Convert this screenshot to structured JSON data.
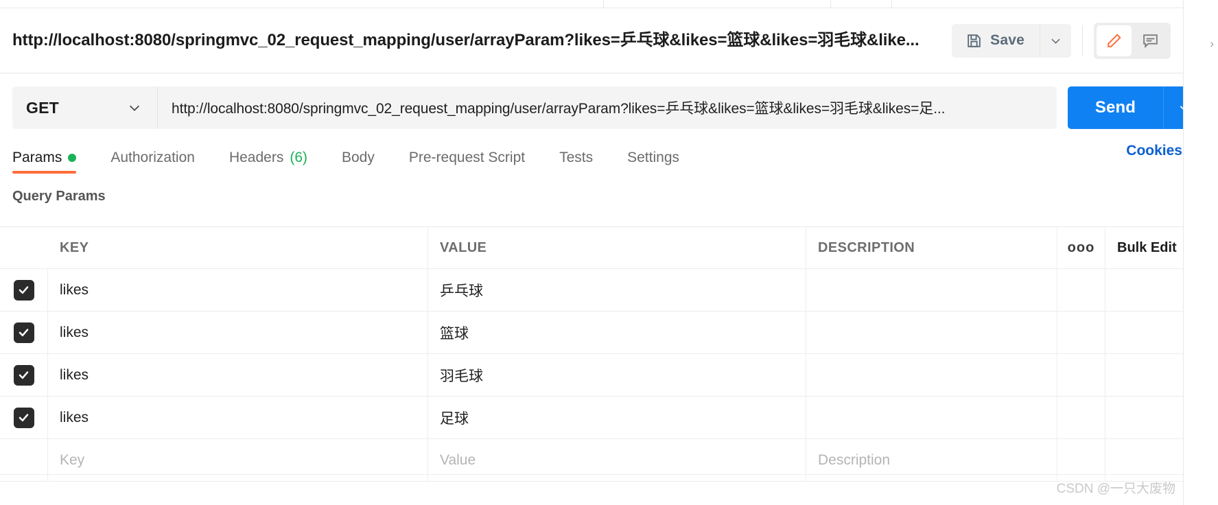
{
  "app": "Postman",
  "header": {
    "request_title": "http://localhost:8080/springmvc_02_request_mapping/user/arrayParam?likes=乒乓球&likes=篮球&likes=羽毛球&like...",
    "save_label": "Save",
    "save_icon": "floppy-disk-icon",
    "save_caret_icon": "chevron-down-icon",
    "edit_icon": "pencil-icon",
    "comment_icon": "comment-icon"
  },
  "url_bar": {
    "method": "GET",
    "method_caret_icon": "chevron-down-icon",
    "url": "http://localhost:8080/springmvc_02_request_mapping/user/arrayParam?likes=乒乓球&likes=篮球&likes=羽毛球&likes=足...",
    "send_label": "Send",
    "send_caret_icon": "chevron-down-icon"
  },
  "tabs": [
    {
      "label": "Params",
      "active": true,
      "dot": true
    },
    {
      "label": "Authorization",
      "active": false
    },
    {
      "label": "Headers",
      "active": false,
      "count": "(6)"
    },
    {
      "label": "Body",
      "active": false
    },
    {
      "label": "Pre-request Script",
      "active": false
    },
    {
      "label": "Tests",
      "active": false
    },
    {
      "label": "Settings",
      "active": false
    }
  ],
  "cookies_link": "Cookies",
  "params": {
    "section_title": "Query Params",
    "columns": {
      "key": "KEY",
      "value": "VALUE",
      "description": "DESCRIPTION"
    },
    "more_icon": "ooo",
    "bulk_edit": "Bulk Edit",
    "rows": [
      {
        "checked": true,
        "key": "likes",
        "value": "乒乓球",
        "description": ""
      },
      {
        "checked": true,
        "key": "likes",
        "value": "篮球",
        "description": ""
      },
      {
        "checked": true,
        "key": "likes",
        "value": "羽毛球",
        "description": ""
      },
      {
        "checked": true,
        "key": "likes",
        "value": "足球",
        "description": ""
      }
    ],
    "placeholder_row": {
      "key": "Key",
      "value": "Value",
      "description": "Description"
    }
  },
  "watermark": "CSDN @一只大废物",
  "colors": {
    "accent_orange": "#ff6c37",
    "send_blue": "#0f81f2",
    "link_blue": "#0b5fd1",
    "status_green": "#1bb157",
    "checkbox_dark": "#2b2b2b"
  }
}
